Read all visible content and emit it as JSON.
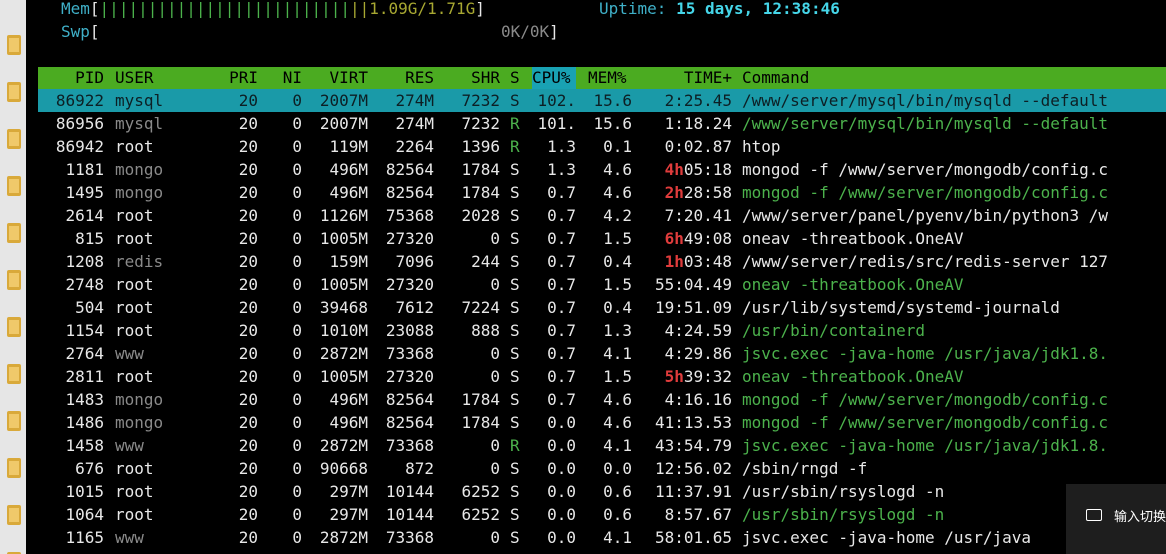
{
  "header": {
    "mem_label": "Mem",
    "mem_bar": "||||||||||||||||||||||||||",
    "mem_bar_tail": "||",
    "mem_value": "1.09G/1.71G",
    "swp_label": "Swp",
    "swp_value": "0K/0K",
    "uptime_label": "Uptime:",
    "uptime_value": "15 days, 12:38:46"
  },
  "columns": [
    "PID",
    "USER",
    "PRI",
    "NI",
    "VIRT",
    "RES",
    "SHR",
    "S",
    "CPU%",
    "MEM%",
    "TIME+",
    "Command"
  ],
  "processes": [
    {
      "pid": "86922",
      "user": "mysql",
      "pri": "20",
      "ni": "0",
      "virt": "2007M",
      "res": "274M",
      "shr": "7232",
      "s": "S",
      "cpu": "102.",
      "mem": "15.6",
      "time": "2:25.45",
      "cmd": "/www/server/mysql/bin/mysqld --default",
      "selected": true
    },
    {
      "pid": "86956",
      "user": "mysql",
      "pri": "20",
      "ni": "0",
      "virt": "2007M",
      "res": "274M",
      "shr": "7232",
      "s": "R",
      "cpu": "101.",
      "mem": "15.6",
      "time": "1:18.24",
      "cmd": "/www/server/mysql/bin/mysqld --default"
    },
    {
      "pid": "86942",
      "user": "root",
      "pri": "20",
      "ni": "0",
      "virt": "119M",
      "res": "2264",
      "shr": "1396",
      "s": "R",
      "cpu": "1.3",
      "mem": "0.1",
      "time": "0:02.87",
      "cmd": "htop"
    },
    {
      "pid": "1181",
      "user": "mongo",
      "pri": "20",
      "ni": "0",
      "virt": "496M",
      "res": "82564",
      "shr": "1784",
      "s": "S",
      "cpu": "1.3",
      "mem": "4.6",
      "time": "4h05:18",
      "cmd": "mongod -f /www/server/mongodb/config.c"
    },
    {
      "pid": "1495",
      "user": "mongo",
      "pri": "20",
      "ni": "0",
      "virt": "496M",
      "res": "82564",
      "shr": "1784",
      "s": "S",
      "cpu": "0.7",
      "mem": "4.6",
      "time": "2h28:58",
      "cmd": "mongod -f /www/server/mongodb/config.c"
    },
    {
      "pid": "2614",
      "user": "root",
      "pri": "20",
      "ni": "0",
      "virt": "1126M",
      "res": "75368",
      "shr": "2028",
      "s": "S",
      "cpu": "0.7",
      "mem": "4.2",
      "time": "7:20.41",
      "cmd": "/www/server/panel/pyenv/bin/python3 /w"
    },
    {
      "pid": "815",
      "user": "root",
      "pri": "20",
      "ni": "0",
      "virt": "1005M",
      "res": "27320",
      "shr": "0",
      "s": "S",
      "cpu": "0.7",
      "mem": "1.5",
      "time": "6h49:08",
      "cmd": "oneav -threatbook.OneAV"
    },
    {
      "pid": "1208",
      "user": "redis",
      "pri": "20",
      "ni": "0",
      "virt": "159M",
      "res": "7096",
      "shr": "244",
      "s": "S",
      "cpu": "0.7",
      "mem": "0.4",
      "time": "1h03:48",
      "cmd": "/www/server/redis/src/redis-server 127"
    },
    {
      "pid": "2748",
      "user": "root",
      "pri": "20",
      "ni": "0",
      "virt": "1005M",
      "res": "27320",
      "shr": "0",
      "s": "S",
      "cpu": "0.7",
      "mem": "1.5",
      "time": "55:04.49",
      "cmd": "oneav -threatbook.OneAV"
    },
    {
      "pid": "504",
      "user": "root",
      "pri": "20",
      "ni": "0",
      "virt": "39468",
      "res": "7612",
      "shr": "7224",
      "s": "S",
      "cpu": "0.7",
      "mem": "0.4",
      "time": "19:51.09",
      "cmd": "/usr/lib/systemd/systemd-journald"
    },
    {
      "pid": "1154",
      "user": "root",
      "pri": "20",
      "ni": "0",
      "virt": "1010M",
      "res": "23088",
      "shr": "888",
      "s": "S",
      "cpu": "0.7",
      "mem": "1.3",
      "time": "4:24.59",
      "cmd": "/usr/bin/containerd"
    },
    {
      "pid": "2764",
      "user": "www",
      "pri": "20",
      "ni": "0",
      "virt": "2872M",
      "res": "73368",
      "shr": "0",
      "s": "S",
      "cpu": "0.7",
      "mem": "4.1",
      "time": "4:29.86",
      "cmd": "jsvc.exec -java-home /usr/java/jdk1.8."
    },
    {
      "pid": "2811",
      "user": "root",
      "pri": "20",
      "ni": "0",
      "virt": "1005M",
      "res": "27320",
      "shr": "0",
      "s": "S",
      "cpu": "0.7",
      "mem": "1.5",
      "time": "5h39:32",
      "cmd": "oneav -threatbook.OneAV"
    },
    {
      "pid": "1483",
      "user": "mongo",
      "pri": "20",
      "ni": "0",
      "virt": "496M",
      "res": "82564",
      "shr": "1784",
      "s": "S",
      "cpu": "0.7",
      "mem": "4.6",
      "time": "4:16.16",
      "cmd": "mongod -f /www/server/mongodb/config.c"
    },
    {
      "pid": "1486",
      "user": "mongo",
      "pri": "20",
      "ni": "0",
      "virt": "496M",
      "res": "82564",
      "shr": "1784",
      "s": "S",
      "cpu": "0.0",
      "mem": "4.6",
      "time": "41:13.53",
      "cmd": "mongod -f /www/server/mongodb/config.c"
    },
    {
      "pid": "1458",
      "user": "www",
      "pri": "20",
      "ni": "0",
      "virt": "2872M",
      "res": "73368",
      "shr": "0",
      "s": "R",
      "cpu": "0.0",
      "mem": "4.1",
      "time": "43:54.79",
      "cmd": "jsvc.exec -java-home /usr/java/jdk1.8."
    },
    {
      "pid": "676",
      "user": "root",
      "pri": "20",
      "ni": "0",
      "virt": "90668",
      "res": "872",
      "shr": "0",
      "s": "S",
      "cpu": "0.0",
      "mem": "0.0",
      "time": "12:56.02",
      "cmd": "/sbin/rngd -f"
    },
    {
      "pid": "1015",
      "user": "root",
      "pri": "20",
      "ni": "0",
      "virt": "297M",
      "res": "10144",
      "shr": "6252",
      "s": "S",
      "cpu": "0.0",
      "mem": "0.6",
      "time": "11:37.91",
      "cmd": "/usr/sbin/rsyslogd -n"
    },
    {
      "pid": "1064",
      "user": "root",
      "pri": "20",
      "ni": "0",
      "virt": "297M",
      "res": "10144",
      "shr": "6252",
      "s": "S",
      "cpu": "0.0",
      "mem": "0.6",
      "time": "8:57.67",
      "cmd": "/usr/sbin/rsyslogd -n"
    },
    {
      "pid": "1165",
      "user": "www",
      "pri": "20",
      "ni": "0",
      "virt": "2872M",
      "res": "73368",
      "shr": "0",
      "s": "S",
      "cpu": "0.0",
      "mem": "4.1",
      "time": "58:01.65",
      "cmd": "jsvc.exec -java-home /usr/java"
    }
  ],
  "ime_popup": {
    "text": "输入切换"
  },
  "colors": {
    "header_bg": "#4bab21",
    "selected_bg": "#1a9aa8",
    "sort_col_bg": "#19a2b3"
  }
}
